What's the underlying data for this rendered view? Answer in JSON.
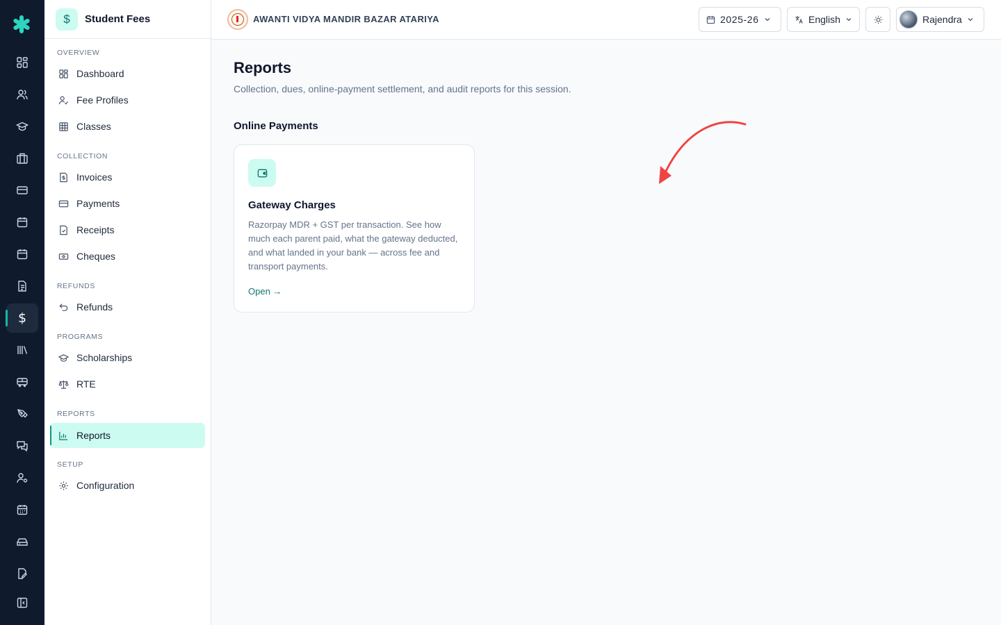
{
  "sidebar": {
    "title": "Student Fees",
    "sections": [
      {
        "label": "OVERVIEW",
        "items": [
          {
            "label": "Dashboard"
          },
          {
            "label": "Fee Profiles"
          },
          {
            "label": "Classes"
          }
        ]
      },
      {
        "label": "COLLECTION",
        "items": [
          {
            "label": "Invoices"
          },
          {
            "label": "Payments"
          },
          {
            "label": "Receipts"
          },
          {
            "label": "Cheques"
          }
        ]
      },
      {
        "label": "REFUNDS",
        "items": [
          {
            "label": "Refunds"
          }
        ]
      },
      {
        "label": "PROGRAMS",
        "items": [
          {
            "label": "Scholarships"
          },
          {
            "label": "RTE"
          }
        ]
      },
      {
        "label": "REPORTS",
        "items": [
          {
            "label": "Reports"
          }
        ]
      },
      {
        "label": "SETUP",
        "items": [
          {
            "label": "Configuration"
          }
        ]
      }
    ]
  },
  "header": {
    "school_name": "AWANTI VIDYA MANDIR BAZAR ATARIYA",
    "session": "2025-26",
    "language": "English",
    "user_name": "Rajendra"
  },
  "main": {
    "title": "Reports",
    "subtitle": "Collection, dues, online-payment settlement, and audit reports for this session.",
    "section_title": "Online Payments",
    "card": {
      "title": "Gateway Charges",
      "description": "Razorpay MDR + GST per transaction. See how much each parent paid, what the gateway deducted, and what landed in your bank — across fee and transport payments.",
      "link": "Open →"
    }
  },
  "colors": {
    "accent": "#0d9488",
    "accent_light": "#ccfbf1",
    "rail_bg": "#0f1b2d",
    "annotation_arrow": "#ef4444"
  }
}
